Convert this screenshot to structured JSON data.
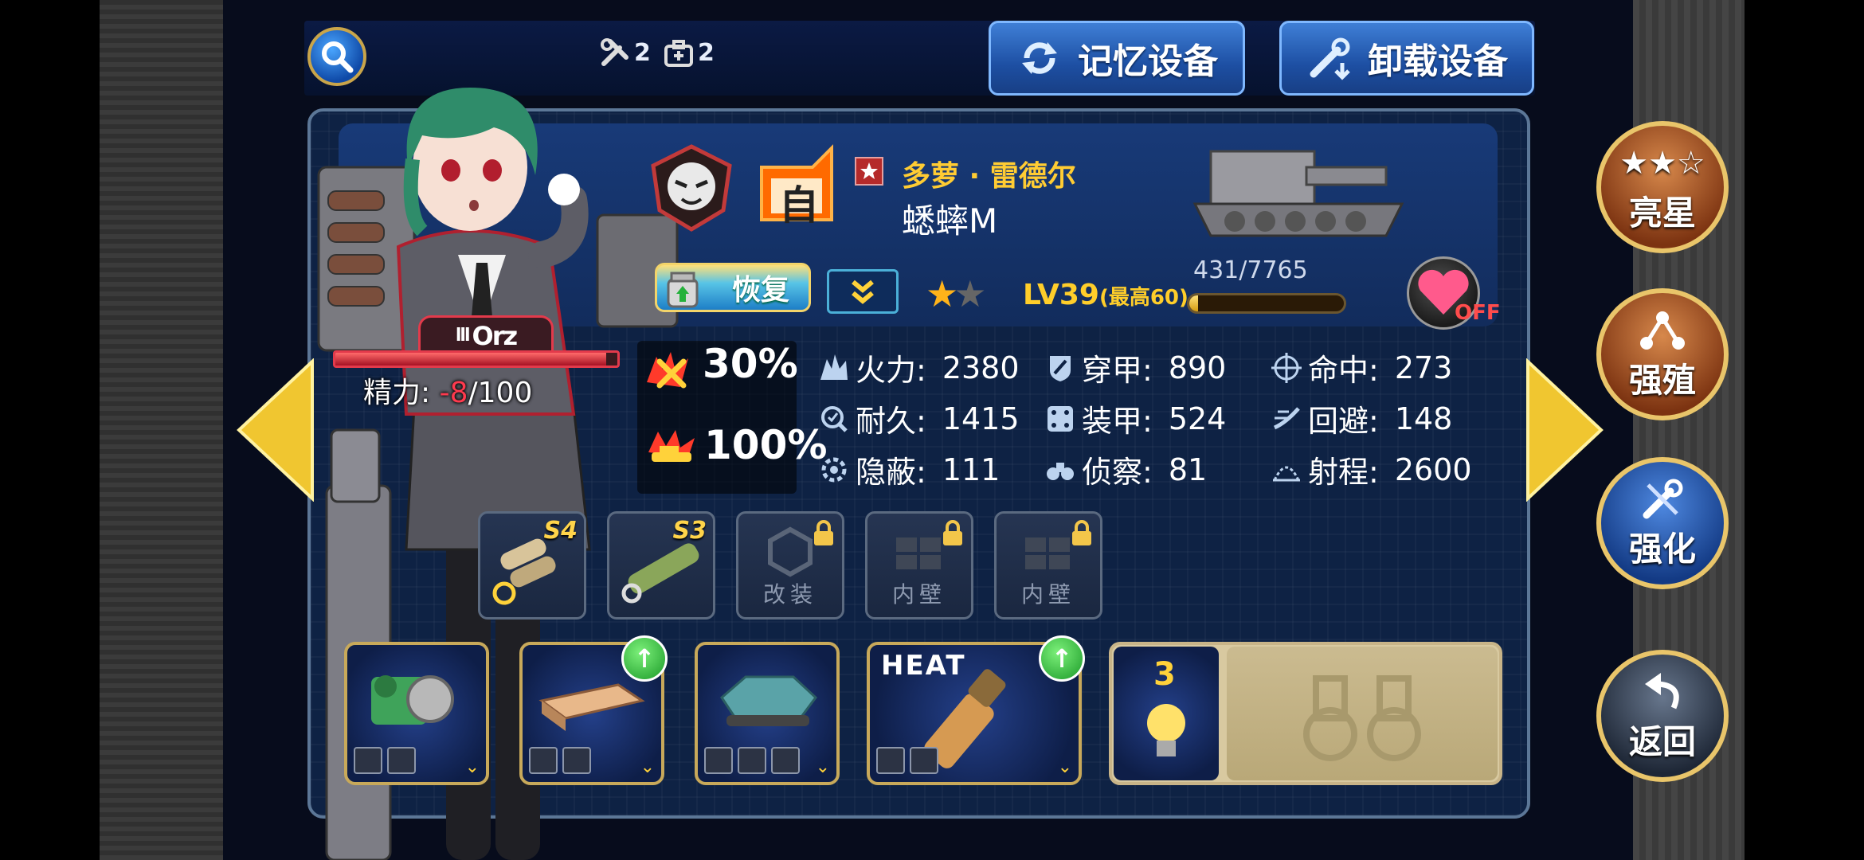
{
  "top_bar": {
    "repair_count": "2",
    "medkit_count": "2",
    "memory_button": "记忆设备",
    "unload_button": "卸载设备"
  },
  "unit": {
    "commander_name": "多萝 · 雷德尔",
    "tank_name": "蟋蟀M",
    "auto_badge": "自",
    "recover_button": "恢复",
    "stars_filled": 1,
    "stars_total": 2,
    "level": "LV39",
    "level_max": "(最高60)",
    "exp_text": "431/7765",
    "exp_fraction": 0.0555,
    "favorite_state": "OFF"
  },
  "stamina": {
    "tag": "Orz",
    "tag_prefix": "lll",
    "label": "精力:",
    "current": "-8",
    "max": "/100",
    "fraction": 0.96
  },
  "effects": [
    {
      "icon": "crossed-fire-icon",
      "value": "30%"
    },
    {
      "icon": "tank-blast-icon",
      "value": "100%"
    }
  ],
  "stats": [
    {
      "icon": "firepower-icon",
      "label": "火力:",
      "value": "2380"
    },
    {
      "icon": "penetration-icon",
      "label": "穿甲:",
      "value": "890"
    },
    {
      "icon": "accuracy-icon",
      "label": "命中:",
      "value": "273"
    },
    {
      "icon": "durability-icon",
      "label": "耐久:",
      "value": "1415"
    },
    {
      "icon": "armor-icon",
      "label": "装甲:",
      "value": "524"
    },
    {
      "icon": "evasion-icon",
      "label": "回避:",
      "value": "148"
    },
    {
      "icon": "stealth-icon",
      "label": "隐蔽:",
      "value": "111"
    },
    {
      "icon": "scouting-icon",
      "label": "侦察:",
      "value": "81"
    },
    {
      "icon": "range-icon",
      "label": "射程:",
      "value": "2600"
    }
  ],
  "parts": [
    {
      "grade": "S4",
      "label": "",
      "locked": false,
      "icon": "gun-barrels-icon"
    },
    {
      "grade": "S3",
      "label": "",
      "locked": false,
      "icon": "camo-barrel-icon"
    },
    {
      "grade": "",
      "label": "改装",
      "locked": true,
      "icon": "hex-nut-icon"
    },
    {
      "grade": "",
      "label": "内壁",
      "locked": true,
      "icon": "inner-wall-icon"
    },
    {
      "grade": "",
      "label": "内壁",
      "locked": true,
      "icon": "inner-wall-icon"
    }
  ],
  "equipment": [
    {
      "name": "engine",
      "upgrade": false
    },
    {
      "name": "armor-plate",
      "upgrade": true
    },
    {
      "name": "chassis",
      "upgrade": false
    },
    {
      "name": "ammo",
      "label": "HEAT",
      "upgrade": true
    }
  ],
  "scout_slot": {
    "count": "3"
  },
  "side_buttons": {
    "star_up": "亮星",
    "breed": "强殖",
    "enhance": "强化",
    "back": "返回"
  },
  "colors": {
    "gold": "#ffcc33",
    "panel": "#0e2244",
    "accent_blue": "#1d4fa3",
    "stamina_red": "#e33a4b"
  }
}
